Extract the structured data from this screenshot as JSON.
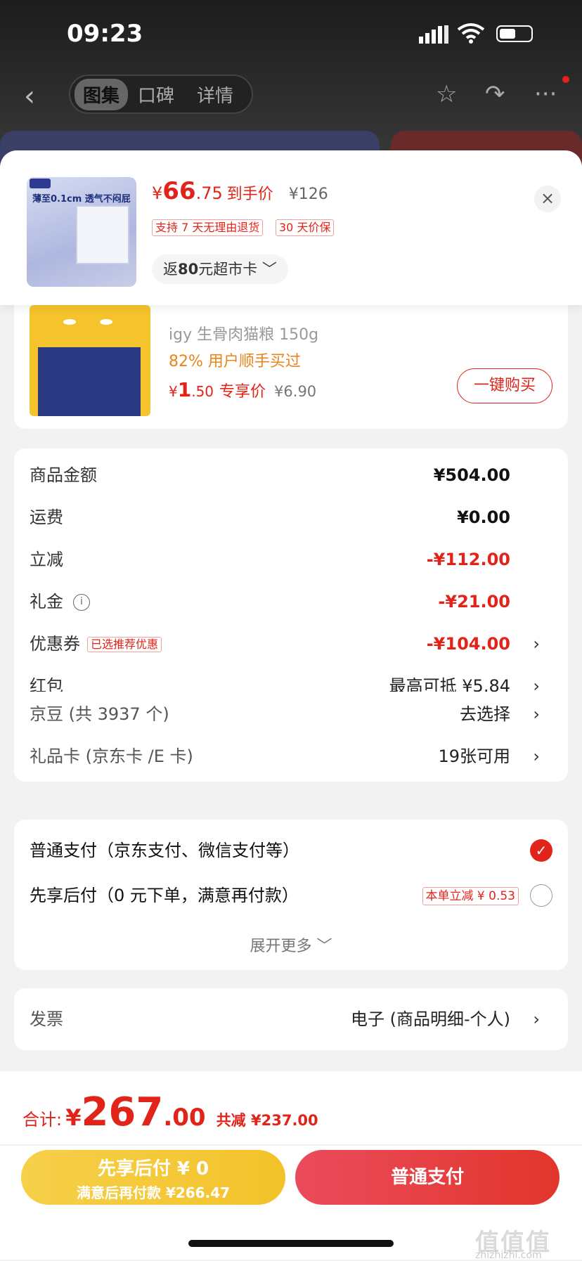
{
  "status_bar": {
    "time": "09:23"
  },
  "nav": {
    "tabs": [
      "图集",
      "口碑",
      "详情"
    ],
    "icons": {
      "back": "‹",
      "star": "☆",
      "share": "↷",
      "more": "···"
    }
  },
  "sheet_header": {
    "currency": "¥",
    "price_int": "66",
    "price_dec": ".75",
    "price_label": "到手价",
    "original_price": "¥126",
    "tags": [
      "支持 7 天无理由退货",
      "30 天价保"
    ],
    "card_pill_prefix": "返",
    "card_pill_amount": "80",
    "card_pill_suffix": "元超市卡",
    "card_pill_chevron": "﹀",
    "close": "×",
    "thumb_text": "薄至0.1cm 透气不闷屁"
  },
  "product": {
    "name": "igy 生骨肉猫粮 150g",
    "bought": "82% 用户顺手买过",
    "currency": "¥",
    "price_int": "1",
    "price_dec": ".50",
    "price_label": "专享价",
    "original_price": "¥6.90",
    "buy_button": "一键购买"
  },
  "summary": {
    "goods_label": "商品金额",
    "goods_value": "¥504.00",
    "shipping_label": "运费",
    "shipping_value": "¥0.00",
    "discount_label": "立减",
    "discount_value": "-¥112.00",
    "gift_label": "礼金",
    "gift_value": "-¥21.00",
    "gift_info": "i",
    "coupon_label": "优惠券",
    "coupon_tag": "已选推荐优惠",
    "coupon_value": "-¥104.00",
    "redpacket_label": "红包",
    "redpacket_value": "最高可抵 ¥5.84",
    "jingdou_label": "京豆 (共 3937 个)",
    "jingdou_value": "去选择",
    "giftcard_label": "礼品卡 (京东卡 /E 卡)",
    "giftcard_value": "19张可用",
    "arrow": "›"
  },
  "payment": {
    "option1": "普通支付（京东支付、微信支付等）",
    "option2": "先享后付（0 元下单，满意再付款）",
    "option2_tag": "本单立减 ¥ 0.53",
    "check": "✓",
    "expand": "展开更多 ﹀"
  },
  "invoice": {
    "label": "发票",
    "value": "电子 (商品明细-个人)",
    "arrow": "›"
  },
  "footer": {
    "total_label": "合计:",
    "currency": "¥",
    "total_int": "267",
    "total_dec": ".00",
    "total_saved": "共减 ¥237.00",
    "later_line1": "先享后付 ¥ 0",
    "later_line2": "满意后再付款 ¥266.47",
    "pay_button": "普通支付"
  },
  "watermark": {
    "text": "值值值",
    "url": "zhizhizhi.com"
  },
  "colors": {
    "accent": "#e2231a",
    "orange": "#e8851a",
    "yellow": "#f3c22a"
  }
}
